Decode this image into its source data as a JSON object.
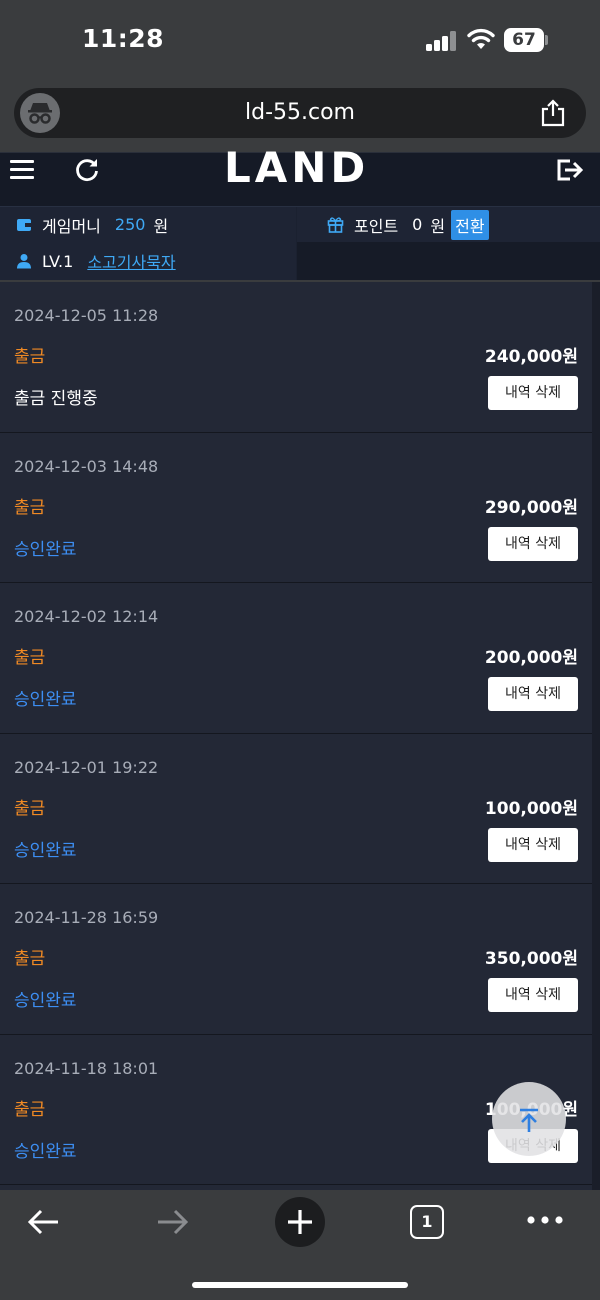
{
  "status_bar": {
    "time": "11:28",
    "battery": "67"
  },
  "browser": {
    "url": "ld-55.com"
  },
  "site": {
    "logo_main": "LAN",
    "logo_accent": "D"
  },
  "account": {
    "money_label": "게임머니",
    "money_value": "250",
    "money_unit": "원",
    "point_label": "포인트",
    "point_value": "0",
    "point_unit": "원",
    "convert_label": "전환",
    "level": "LV.1",
    "nickname": "소고기사묵자"
  },
  "history": [
    {
      "date": "2024-12-05 11:28",
      "type": "출금",
      "amount": "240,000원",
      "status": "출금 진행중",
      "delete_label": "내역 삭제"
    },
    {
      "date": "2024-12-03 14:48",
      "type": "출금",
      "amount": "290,000원",
      "status": "승인완료",
      "delete_label": "내역 삭제"
    },
    {
      "date": "2024-12-02 12:14",
      "type": "출금",
      "amount": "200,000원",
      "status": "승인완료",
      "delete_label": "내역 삭제"
    },
    {
      "date": "2024-12-01 19:22",
      "type": "출금",
      "amount": "100,000원",
      "status": "승인완료",
      "delete_label": "내역 삭제"
    },
    {
      "date": "2024-11-28 16:59",
      "type": "출금",
      "amount": "350,000원",
      "status": "승인완료",
      "delete_label": "내역 삭제"
    },
    {
      "date": "2024-11-18 18:01",
      "type": "출금",
      "amount": "100,000원",
      "status": "승인완료",
      "delete_label": "내역 삭제"
    }
  ],
  "toolbar": {
    "tab_count": "1"
  },
  "colors": {
    "accent": "#3fa9f5",
    "withdraw": "#f08a24",
    "approved": "#3d8ef2"
  },
  "icons": [
    "incognito-icon",
    "share-icon",
    "hamburger-menu-icon",
    "refresh-icon",
    "logout-icon",
    "wallet-icon",
    "gift-icon",
    "user-icon",
    "arrow-up-icon",
    "back-arrow-icon",
    "forward-arrow-icon",
    "plus-icon",
    "tabs-icon",
    "more-icon"
  ]
}
